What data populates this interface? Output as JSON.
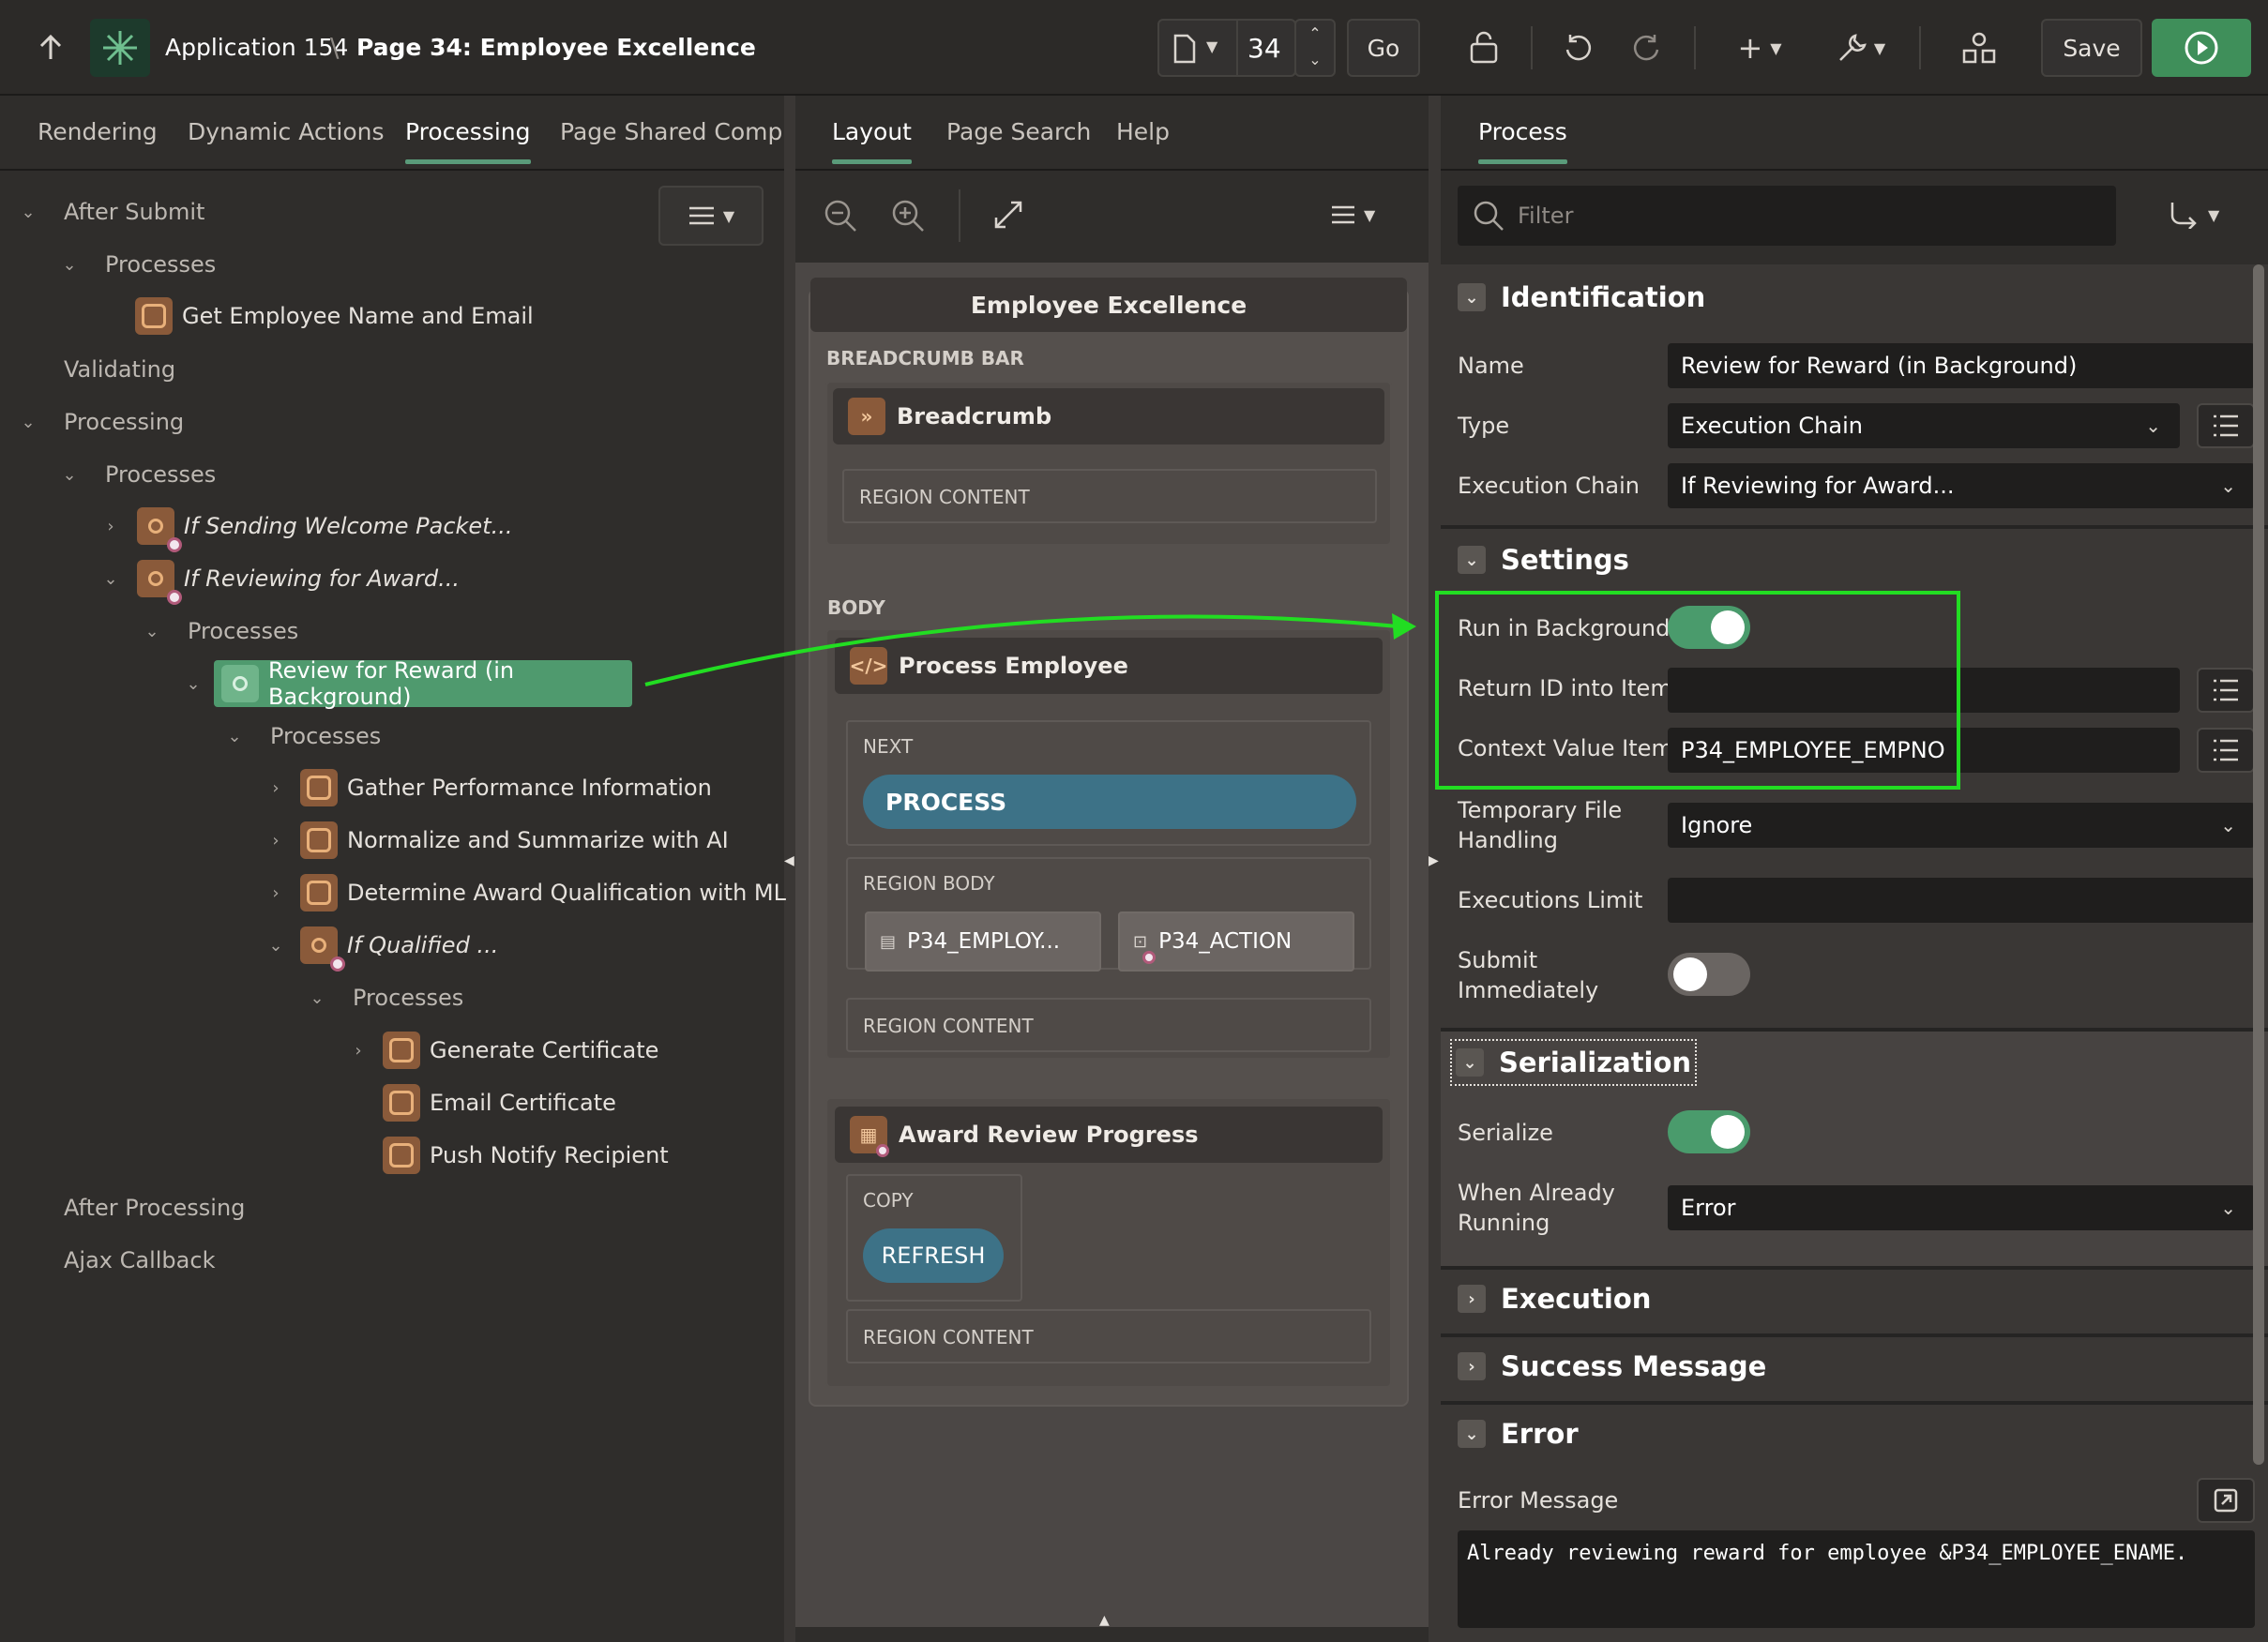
{
  "header": {
    "app_name": "Application 154",
    "separator": "\\",
    "page_title": "Page 34: Employee Excellence",
    "page_number": "34",
    "go_label": "Go",
    "save_label": "Save"
  },
  "left_tabs": [
    "Rendering",
    "Dynamic Actions",
    "Processing",
    "Page Shared Compon"
  ],
  "tree": {
    "after_submit": "After Submit",
    "processes_1": "Processes",
    "get_employee": "Get Employee Name and Email",
    "validating": "Validating",
    "processing": "Processing",
    "processes_2": "Processes",
    "if_sending": "If Sending Welcome Packet...",
    "if_reviewing": "If Reviewing for Award...",
    "processes_3": "Processes",
    "review_reward": "Review for Reward (in Background)",
    "processes_4": "Processes",
    "gather": "Gather Performance Information",
    "normalize": "Normalize and Summarize with AI",
    "determine": "Determine Award Qualification with ML",
    "if_qualified": "If Qualified ...",
    "processes_5": "Processes",
    "generate": "Generate Certificate",
    "email_cert": "Email Certificate",
    "push_notify": "Push Notify Recipient",
    "after_processing": "After Processing",
    "ajax_callback": "Ajax Callback"
  },
  "middle_tabs": [
    "Layout",
    "Page Search",
    "Help"
  ],
  "layout": {
    "page_name": "Employee Excellence",
    "breadcrumb_bar": "BREADCRUMB BAR",
    "breadcrumb_region": "Breadcrumb",
    "region_content_1": "REGION CONTENT",
    "body": "BODY",
    "process_employee": "Process Employee",
    "next": "NEXT",
    "process_button": "PROCESS",
    "region_body": "REGION BODY",
    "item_empno": "P34_EMPLOY...",
    "item_action": "P34_ACTION",
    "region_content_2": "REGION CONTENT",
    "award_review": "Award Review Progress",
    "copy": "COPY",
    "refresh_button": "REFRESH",
    "region_content_3": "REGION CONTENT"
  },
  "right_tab": "Process",
  "filter_placeholder": "Filter",
  "identification": {
    "title": "Identification",
    "name_label": "Name",
    "name_value": "Review for Reward (in Background)",
    "type_label": "Type",
    "type_value": "Execution Chain",
    "chain_label": "Execution Chain",
    "chain_value": "If Reviewing for Award..."
  },
  "settings": {
    "title": "Settings",
    "run_bg_label": "Run in Background",
    "run_bg_on": true,
    "return_id_label": "Return ID into Item",
    "return_id_value": "",
    "context_label": "Context Value Item",
    "context_value": "P34_EMPLOYEE_EMPNO",
    "temp_file_label_1": "Temporary File",
    "temp_file_label_2": "Handling",
    "temp_file_value": "Ignore",
    "exec_limit_label": "Executions Limit",
    "exec_limit_value": "",
    "submit_label_1": "Submit",
    "submit_label_2": "Immediately",
    "submit_on": false
  },
  "serialization": {
    "title": "Serialization",
    "serialize_label": "Serialize",
    "serialize_on": true,
    "when_running_label_1": "When Already",
    "when_running_label_2": "Running",
    "when_running_value": "Error"
  },
  "execution": {
    "title": "Execution"
  },
  "success": {
    "title": "Success Message"
  },
  "error": {
    "title": "Error",
    "message_label": "Error Message",
    "message_value": "Already reviewing reward for employee &P34_EMPLOYEE_ENAME."
  },
  "colors": {
    "accent_green": "#5a9b7a",
    "toggle_on": "#4a9b6c",
    "annotation_green": "#22dd22",
    "button_teal": "#3d7287",
    "process_icon": "#8a5a3a",
    "run_button": "#3f8f5a"
  }
}
